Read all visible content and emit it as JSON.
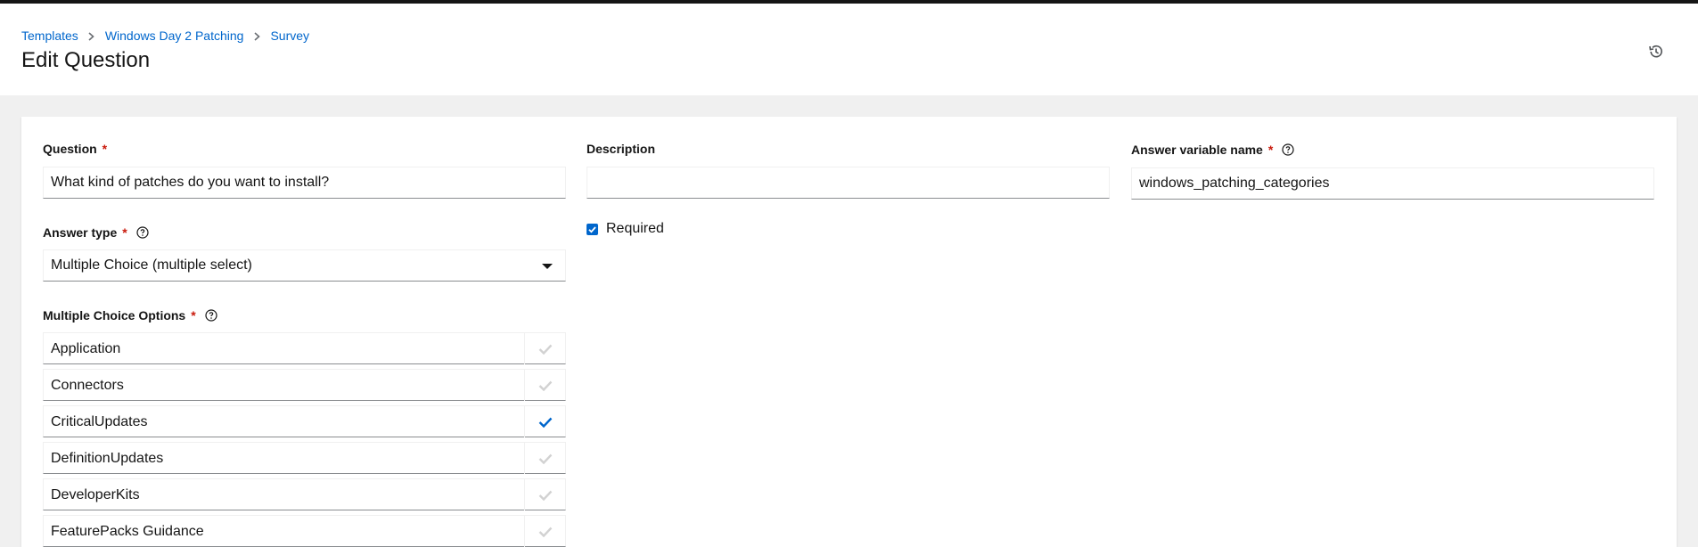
{
  "breadcrumb": {
    "items": [
      {
        "label": "Templates"
      },
      {
        "label": "Windows Day 2 Patching"
      },
      {
        "label": "Survey"
      }
    ]
  },
  "page": {
    "title": "Edit Question",
    "history_icon": "history-icon"
  },
  "form": {
    "question": {
      "label": "Question",
      "value": "What kind of patches do you want to install?",
      "required_mark": "*"
    },
    "description": {
      "label": "Description",
      "value": ""
    },
    "variable": {
      "label": "Answer variable name",
      "value": "windows_patching_categories",
      "required_mark": "*",
      "help_icon": "question-circle-icon"
    },
    "answer_type": {
      "label": "Answer type",
      "value": "Multiple Choice (multiple select)",
      "required_mark": "*",
      "help_icon": "question-circle-icon"
    },
    "required": {
      "label": "Required",
      "checked": true
    },
    "choices": {
      "label": "Multiple Choice Options",
      "required_mark": "*",
      "help_icon": "question-circle-icon",
      "options": [
        {
          "label": "Application",
          "selected": false
        },
        {
          "label": "Connectors",
          "selected": false
        },
        {
          "label": "CriticalUpdates",
          "selected": true
        },
        {
          "label": "DefinitionUpdates",
          "selected": false
        },
        {
          "label": "DeveloperKits",
          "selected": false
        },
        {
          "label": "FeaturePacks Guidance",
          "selected": false
        }
      ]
    }
  },
  "colors": {
    "link": "#0066cc",
    "required": "#c9190b",
    "check_selected": "#0066cc",
    "check_unselected": "#d2d2d2"
  }
}
